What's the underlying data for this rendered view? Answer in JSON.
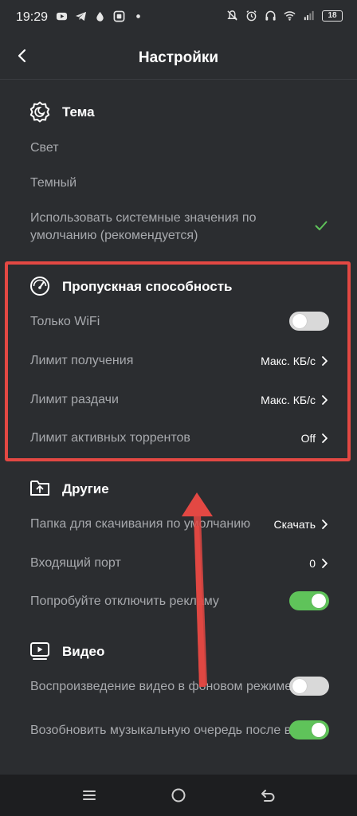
{
  "status_bar": {
    "time": "19:29",
    "battery": "18",
    "left_icons": [
      "youtube-icon",
      "telegram-icon",
      "drop-icon",
      "app-icon",
      "dot-icon"
    ],
    "right_icons": [
      "mute-icon",
      "alarm-icon",
      "headphones-icon",
      "wifi-icon",
      "signal-icon"
    ]
  },
  "header": {
    "title": "Настройки"
  },
  "theme": {
    "title": "Тема",
    "options": [
      {
        "label": "Свет"
      },
      {
        "label": "Темный"
      },
      {
        "label": "Использовать системные значения по умолчанию (рекомендуется)",
        "checked": true
      }
    ]
  },
  "bandwidth": {
    "title": "Пропускная способность",
    "wifi_only": {
      "label": "Только WiFi",
      "enabled": false
    },
    "download_limit": {
      "label": "Лимит получения",
      "value": "Макс. КБ/с"
    },
    "upload_limit": {
      "label": "Лимит раздачи",
      "value": "Макс. КБ/с"
    },
    "active_torrents": {
      "label": "Лимит активных торрентов",
      "value": "Off"
    }
  },
  "other": {
    "title": "Другие",
    "download_folder": {
      "label": "Папка для скачивания по умолчанию",
      "value": "Скачать"
    },
    "incoming_port": {
      "label": "Входящий порт",
      "value": "0"
    },
    "disable_ads": {
      "label": "Попробуйте отключить рекламу",
      "enabled": true
    }
  },
  "video": {
    "title": "Видео",
    "background_play": {
      "label": "Воспроизведение видео в фоновом режиме",
      "enabled": false
    },
    "resume_music": {
      "label": "Возобновить музыкальную очередь после видео",
      "enabled": true
    }
  },
  "colors": {
    "background": "#2b2d30",
    "label_text": "#a7a9ad",
    "toggle_on": "#5fc35a",
    "toggle_off": "#d9d9d9",
    "check": "#5fc35a",
    "annotation": "#e34843"
  }
}
